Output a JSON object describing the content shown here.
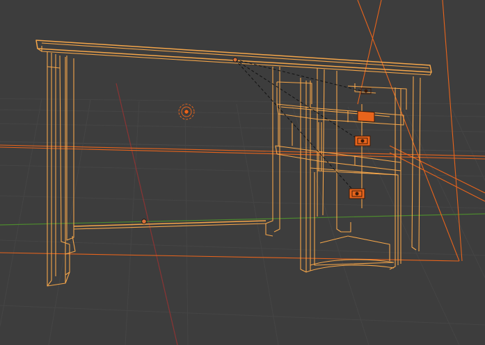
{
  "viewport": {
    "mode": "wireframe",
    "colors": {
      "background": "#3d3d3d",
      "grid": "#454545",
      "x_axis": "#8a3434",
      "y_axis": "#4d8a2e",
      "selected_wire": "#f5a64a",
      "active_wire": "#ffb866",
      "lamp_light_lines": "#e8641c",
      "handle_fill": "#e8641c",
      "origin_dot": "#d8703a",
      "parent_relation": "#111111"
    },
    "objects": [
      {
        "name": "desk-top",
        "selected": true
      },
      {
        "name": "desk-left-leg-panel",
        "selected": true
      },
      {
        "name": "desk-drawer-cabinet",
        "selected": true
      },
      {
        "name": "drawer-handle-top",
        "selected": true,
        "icon": "handle"
      },
      {
        "name": "drawer-handle-middle",
        "selected": true,
        "icon": "handle"
      },
      {
        "name": "drawer-handle-bottom",
        "selected": true,
        "icon": "handle"
      },
      {
        "name": "lamp-object",
        "selected": false,
        "icon": "lamp"
      }
    ]
  }
}
